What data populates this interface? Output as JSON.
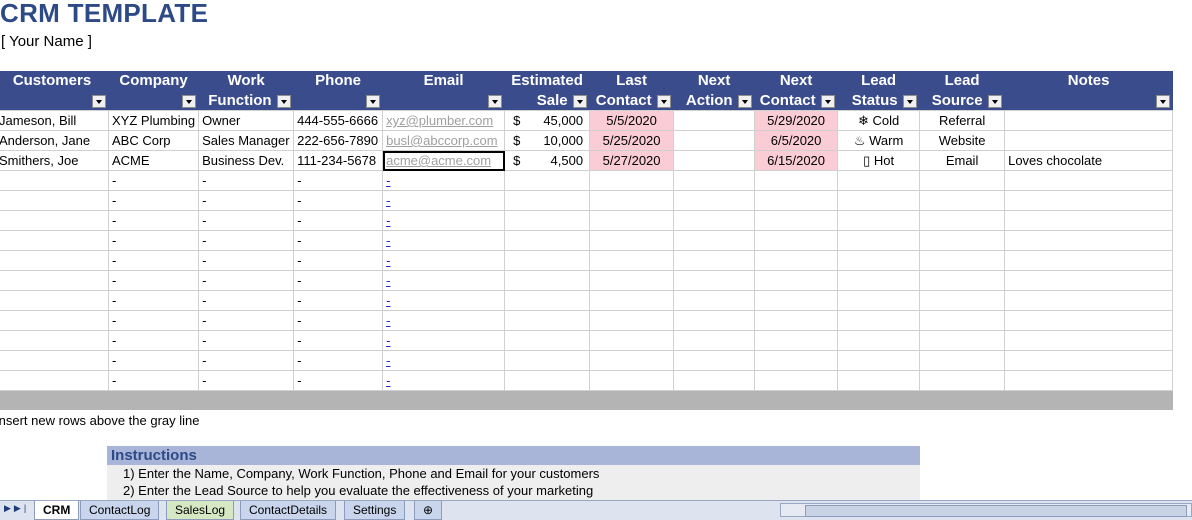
{
  "title": "CRM TEMPLATE",
  "subtitle": "[ Your Name ]",
  "headers": [
    {
      "l1": "Customers",
      "l2": ""
    },
    {
      "l1": "Company",
      "l2": ""
    },
    {
      "l1": "Work",
      "l2": "Function"
    },
    {
      "l1": "Phone",
      "l2": ""
    },
    {
      "l1": "Email",
      "l2": ""
    },
    {
      "l1": "Estimated",
      "l2": "Sale"
    },
    {
      "l1": "Last",
      "l2": "Contact"
    },
    {
      "l1": "Next",
      "l2": "Action"
    },
    {
      "l1": "Next",
      "l2": "Contact"
    },
    {
      "l1": "Lead",
      "l2": "Status"
    },
    {
      "l1": "Lead",
      "l2": "Source"
    },
    {
      "l1": "Notes",
      "l2": ""
    }
  ],
  "rows": [
    {
      "customer": "Jameson, Bill",
      "company": "XYZ Plumbing",
      "work": "Owner",
      "phone": "444-555-6666",
      "email": "xyz@plumber.com",
      "currency": "$",
      "sale": "45,000",
      "last": "5/5/2020",
      "action": "",
      "next": "5/29/2020",
      "status": "❄ Cold",
      "source": "Referral",
      "notes": ""
    },
    {
      "customer": "Anderson, Jane",
      "company": "ABC Corp",
      "work": "Sales Manager",
      "phone": "222-656-7890",
      "email": "busl@abccorp.com",
      "currency": "$",
      "sale": "10,000",
      "last": "5/25/2020",
      "action": "",
      "next": "6/5/2020",
      "status": "♨ Warm",
      "source": "Website",
      "notes": ""
    },
    {
      "customer": "Smithers, Joe",
      "company": "ACME",
      "work": "Business Dev.",
      "phone": "111-234-5678",
      "email": "acme@acme.com",
      "currency": "$",
      "sale": "4,500",
      "last": "5/27/2020",
      "action": "",
      "next": "6/15/2020",
      "status": "▯ Hot",
      "source": "Email",
      "notes": "Loves chocolate"
    }
  ],
  "empty_rows": 11,
  "placeholder": "-",
  "email_placeholder": "-",
  "note": "Insert new rows above the gray line",
  "instructions": {
    "heading": "Instructions",
    "lines": [
      "1) Enter the Name, Company, Work Function, Phone and Email for your customers",
      "2) Enter the Lead Source to help you evaluate the effectiveness of your marketing"
    ]
  },
  "tabs": [
    "CRM",
    "ContactLog",
    "SalesLog",
    "ContactDetails",
    "Settings"
  ],
  "colors": {
    "header": "#3b4c8c",
    "title": "#2d4a87",
    "pink": "#f9ccd6",
    "gray": "#b4b4b4"
  }
}
